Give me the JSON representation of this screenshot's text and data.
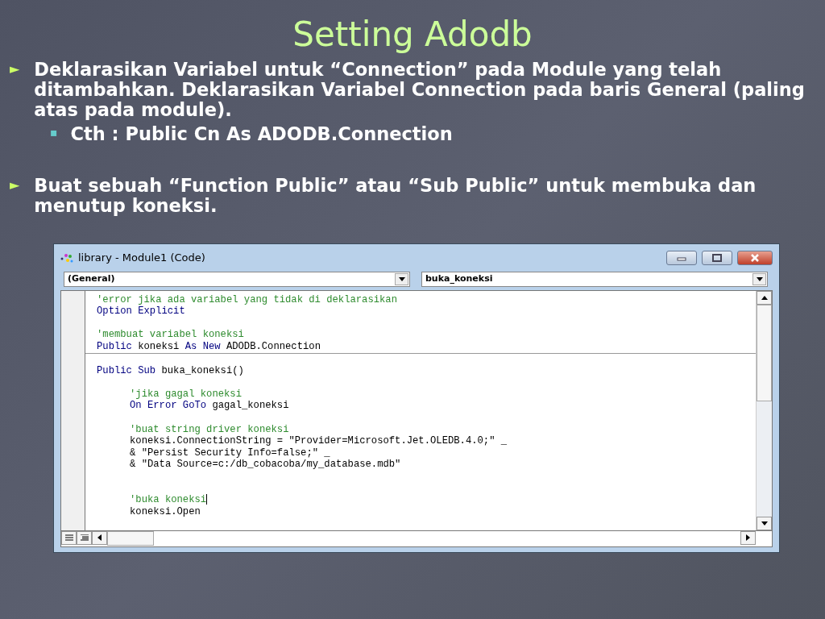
{
  "slide": {
    "title": "Setting Adodb",
    "bullets": [
      {
        "marker": "►",
        "text": "Deklarasikan Variabel untuk “Connection” pada Module yang telah ditambahkan. Deklarasikan Variabel Connection pada baris General (paling atas pada module).",
        "children": [
          {
            "marker": "▪",
            "text": "Cth : Public Cn As ADODB.Connection"
          }
        ]
      },
      {
        "marker": "►",
        "text": "Buat sebuah “Function Public” atau “Sub Public” untuk membuka dan menutup koneksi."
      }
    ]
  },
  "window": {
    "title": "library - Module1 (Code)",
    "object_dropdown": "(General)",
    "procedure_dropdown": "buka_koneksi",
    "declarations": [
      [
        {
          "caret": false,
          "segments": [
            {
              "kind": "comment",
              "text": "'error jika ada variabel yang tidak di deklarasikan"
            }
          ]
        },
        {
          "caret": false,
          "segments": [
            {
              "kind": "keyword",
              "text": "Option Explicit"
            }
          ]
        }
      ],
      [
        {
          "caret": false,
          "segments": [
            {
              "kind": "comment",
              "text": "'membuat variabel koneksi"
            }
          ]
        },
        {
          "caret": false,
          "segments": [
            {
              "kind": "keyword",
              "text": "Public"
            },
            {
              "kind": "plain",
              "text": " koneksi "
            },
            {
              "kind": "keyword",
              "text": "As New"
            },
            {
              "kind": "plain",
              "text": " ADODB.Connection"
            }
          ]
        }
      ]
    ],
    "procedures": [
      {
        "header": [
          {
            "kind": "keyword",
            "text": "Public Sub"
          },
          {
            "kind": "plain",
            "text": " buka_koneksi()"
          }
        ],
        "body": [
          [
            {
              "caret": false,
              "segments": [
                {
                  "kind": "comment",
                  "text": "'jika gagal koneksi"
                }
              ]
            },
            {
              "caret": false,
              "segments": [
                {
                  "kind": "keyword",
                  "text": "On Error GoTo"
                },
                {
                  "kind": "plain",
                  "text": " gagal_koneksi"
                }
              ]
            }
          ],
          [
            {
              "caret": false,
              "segments": [
                {
                  "kind": "comment",
                  "text": "'buat string driver koneksi"
                }
              ]
            },
            {
              "caret": false,
              "segments": [
                {
                  "kind": "plain",
                  "text": "koneksi.ConnectionString = \"Provider=Microsoft.Jet.OLEDB.4.0;\" _"
                }
              ]
            },
            {
              "caret": false,
              "segments": [
                {
                  "kind": "plain",
                  "text": "& \"Persist Security Info=false;\" _"
                }
              ]
            },
            {
              "caret": false,
              "segments": [
                {
                  "kind": "plain",
                  "text": "& \"Data Source=c:/db_cobacoba/my_database.mdb\""
                }
              ]
            }
          ],
          [
            {
              "caret": true,
              "segments": [
                {
                  "kind": "comment",
                  "text": "'buka koneksi"
                }
              ]
            },
            {
              "caret": false,
              "segments": [
                {
                  "kind": "plain",
                  "text": "koneksi.Open"
                }
              ]
            }
          ]
        ]
      }
    ]
  }
}
